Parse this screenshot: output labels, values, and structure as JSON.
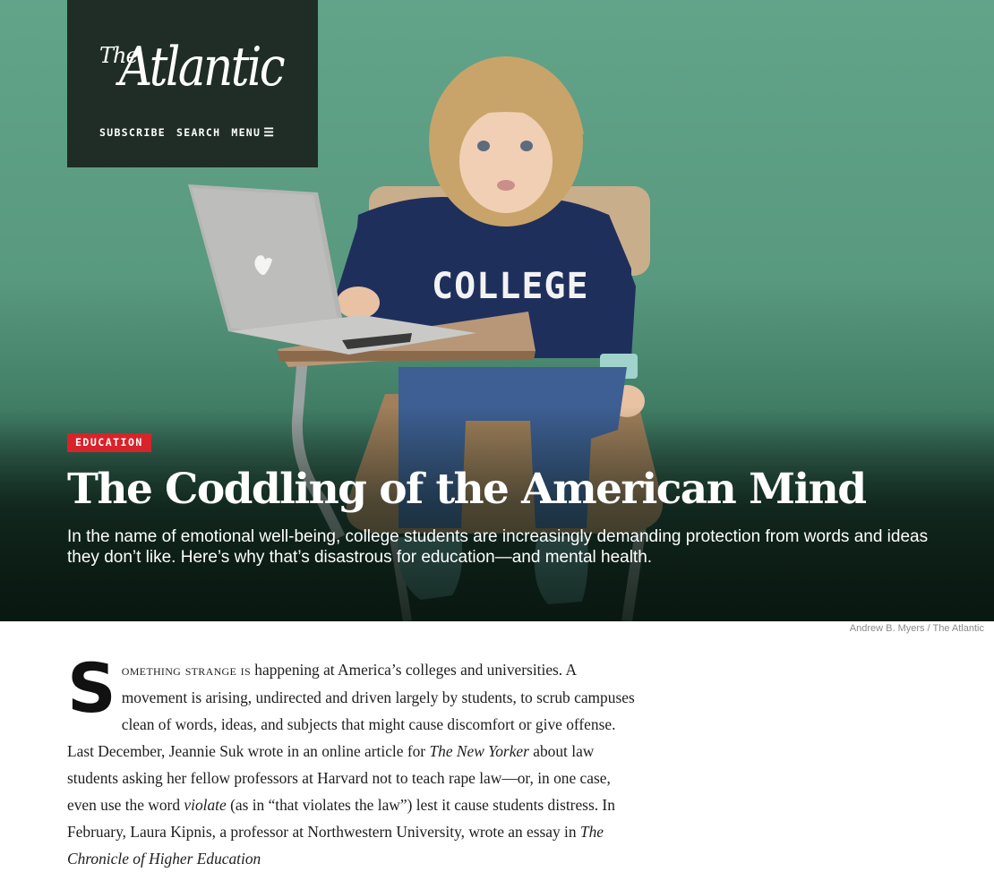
{
  "masthead": {
    "logo_the": "The",
    "logo_name": "Atlantic",
    "nav": [
      {
        "label": "SUBSCRIBE"
      },
      {
        "label": "SEARCH"
      },
      {
        "label": "MENU",
        "icon": "hamburger-icon"
      }
    ]
  },
  "hero": {
    "image_caption_credit": "Andrew B. Myers / The Atlantic",
    "sweatshirt_text": "COLLEGE"
  },
  "article": {
    "section": "EDUCATION",
    "title": "The Coddling of the American Mind",
    "dek": "In the name of emotional well-being, college students are increasingly demanding protection from words and ideas they don’t like. Here’s why that’s disastrous for education—and mental health.",
    "body": {
      "dropcap": "S",
      "lead_in": "omething strange is",
      "t1": " happening at America’s colleges and universities. A movement is arising, undirected and driven largely by students, to scrub campuses clean of words, ideas, and subjects that might cause discomfort or give offense. Last December, Jeannie Suk wrote in an online article for ",
      "i1": "The New Yorker",
      "t2": " about law students asking her fellow professors at Harvard not to teach rape law—or, in one case, even use the word ",
      "i2": "violate",
      "t3": " (as in “that violates the law”) lest it cause students distress. In February, Laura Kipnis, a professor at Northwestern University, wrote an essay in ",
      "i3": "The Chronicle of Higher Education"
    }
  },
  "colors": {
    "hero_green": "#62a489",
    "masthead_bg": "#1f2d26",
    "section_tag_red": "#d8232a"
  }
}
